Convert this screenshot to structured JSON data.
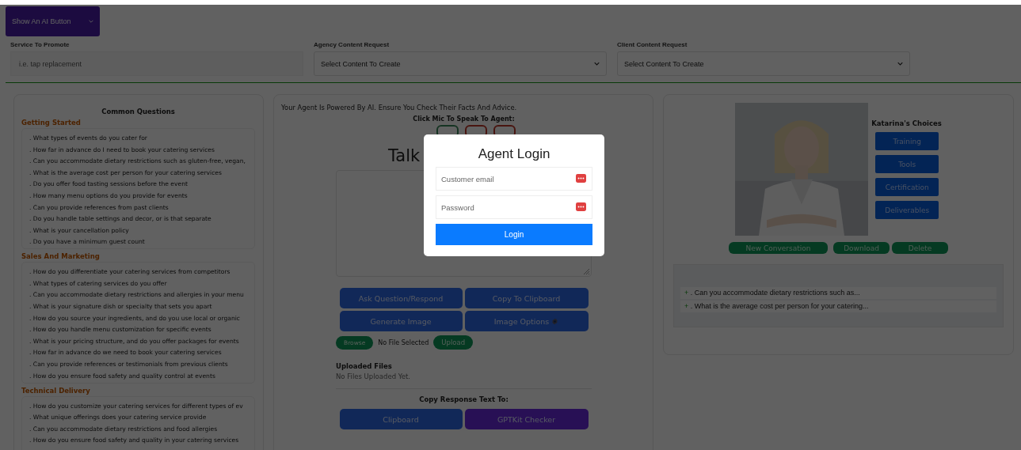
{
  "ai_button": {
    "label": "Show An AI Button"
  },
  "fields": [
    {
      "label": "Service To Promote",
      "kind": "input",
      "placeholder": "i.e. tap replacement"
    },
    {
      "label": "Agency Content Request",
      "kind": "select",
      "value": "Select Content To Create"
    },
    {
      "label": "Client Content Request",
      "kind": "select",
      "value": "Select Content To Create"
    }
  ],
  "questions": {
    "title": "Common Questions",
    "sections": [
      {
        "heading": "Getting Started",
        "items": [
          ". What types of events do you cater for",
          ". How far in advance do I need to book your catering services",
          ". Can you accommodate dietary restrictions such as gluten-free, vegan,",
          ". What is the average cost per person for your catering services",
          ". Do you offer food tasting sessions before the event",
          ". How many menu options do you provide for events",
          ". Can you provide references from past clients",
          ". Do you handle table settings and decor, or is that separate",
          ". What is your cancellation policy",
          ". Do you have a minimum guest count"
        ]
      },
      {
        "heading": "Sales And Marketing",
        "items": [
          ". How do you differentiate your catering services from competitors",
          ". What types of catering services do you offer",
          ". Can you accommodate dietary restrictions and allergies in your menu",
          ". What is your signature dish or specialty that sets you apart",
          ". How do you source your ingredients, and do you use local or organic",
          ". How do you handle menu customization for specific events",
          ". What is your pricing structure, and do you offer packages for events",
          ". How far in advance do we need to book your catering services",
          ". Can you provide references or testimonials from previous clients",
          ". How do you ensure food safety and quality control at events"
        ]
      },
      {
        "heading": "Technical Delivery",
        "items": [
          ". How do you customize your catering services for different types of ev",
          ". What unique offerings does your catering service provide",
          ". Can you accommodate dietary restrictions and food allergies",
          ". How do you ensure food safety and quality in your catering services"
        ]
      }
    ]
  },
  "agent": {
    "disclaimer": "Your Agent Is Powered By AI. Ensure You Check Their Facts And Advice.",
    "mic_prompt": "Click Mic To Speak To Agent:",
    "mic_buttons": [
      {
        "kind": "green"
      },
      {
        "kind": "red"
      },
      {
        "kind": "red"
      }
    ],
    "heading": "Talk",
    "actions": [
      {
        "label": "Ask Question/Respond",
        "kind": "plain"
      },
      {
        "label": "Copy To Clipboard",
        "kind": "plain"
      },
      {
        "label": "Generate Image",
        "kind": "plain"
      },
      {
        "label": "Image Options",
        "kind": "options"
      }
    ],
    "browse": "Browse",
    "file_status": "No File Selected",
    "upload": "Upload",
    "uploaded_title": "Uploaded Files",
    "uploaded_status": "No Files Uploaded Yet.",
    "copy_title": "Copy Response Text To:",
    "copy_targets": [
      {
        "label": "Clipboard",
        "kind": "blue"
      },
      {
        "label": "GPTKit Checker",
        "kind": "purple"
      }
    ]
  },
  "profile": {
    "picture": {
      "kind": "picture"
    },
    "choices_title": "Katarina's Choices",
    "choices": [
      "Training",
      "Tools",
      "Certification",
      "Deliverables"
    ],
    "conversation_buttons": [
      "New Conversation",
      "Download",
      "Delete"
    ],
    "history": [
      {
        "marker": "+",
        "text": ". Can you accommodate dietary restrictions such as..."
      },
      {
        "marker": "+",
        "text": ". What is the average cost per person for your catering..."
      }
    ]
  },
  "login": {
    "title": "Agent Login",
    "fields": [
      {
        "placeholder": "Customer email"
      },
      {
        "placeholder": "Password"
      }
    ],
    "button": "Login"
  }
}
